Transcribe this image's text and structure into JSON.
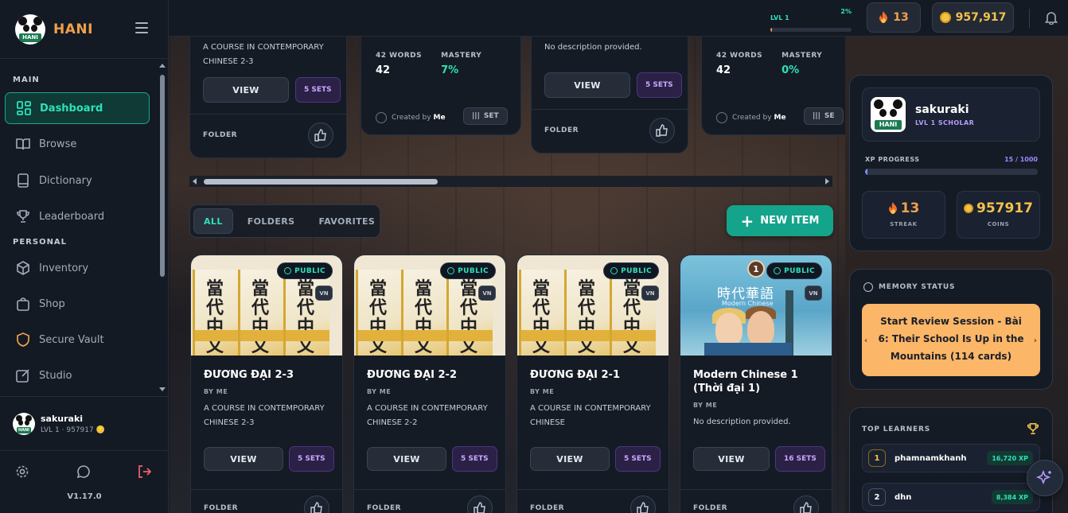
{
  "app": {
    "name": "HANI",
    "version": "V1.17.0"
  },
  "sidebar": {
    "sections": {
      "main": "MAIN",
      "personal": "PERSONAL"
    },
    "items": [
      {
        "label": "Dashboard",
        "icon": "dashboard-icon",
        "active": true
      },
      {
        "label": "Browse",
        "icon": "book-open-icon"
      },
      {
        "label": "Dictionary",
        "icon": "book-icon"
      },
      {
        "label": "Leaderboard",
        "icon": "trophy-icon"
      },
      {
        "label": "Inventory",
        "icon": "box-icon"
      },
      {
        "label": "Shop",
        "icon": "bag-icon"
      },
      {
        "label": "Secure Vault",
        "icon": "shield-icon"
      },
      {
        "label": "Studio",
        "icon": "edit-icon"
      }
    ],
    "user": {
      "name": "sakuraki",
      "meta": "LVL 1 · 957917 🪙"
    }
  },
  "topbar": {
    "level_label": "LVL 1",
    "level_percent_label": "2%",
    "level_progress": 0.02,
    "streak": "13",
    "coins": "957,917"
  },
  "top_row": [
    {
      "desc": "A COURSE IN CONTEMPORARY CHINESE 2-3",
      "view": "VIEW",
      "sets": "5 SETS",
      "folder": "FOLDER"
    },
    {
      "words_label": "42 WORDS",
      "words": "42",
      "mastery_label": "MASTERY",
      "mastery": "7%",
      "created_by": "Created by",
      "creator": "Me",
      "set": "SET"
    },
    {
      "desc": "No description provided.",
      "view": "VIEW",
      "sets": "5 SETS",
      "folder": "FOLDER"
    },
    {
      "words_label": "42 WORDS",
      "words": "42",
      "mastery_label": "MASTERY",
      "mastery": "0%",
      "created_by": "Created by",
      "creator": "Me",
      "set": "SE"
    }
  ],
  "tabs": {
    "all": "ALL",
    "folders": "FOLDERS",
    "favorites": "FAVORITES"
  },
  "new_item": "NEW ITEM",
  "cards": [
    {
      "title": "ĐƯƠNG ĐẠI 2-3",
      "by": "BY ME",
      "desc": "A COURSE IN CONTEMPORARY CHINESE 2-3",
      "view": "VIEW",
      "sets": "5 SETS",
      "folder": "FOLDER",
      "public": "PUBLIC",
      "lang": "VN",
      "cover_text": "當代中文課程"
    },
    {
      "title": "ĐƯƠNG ĐẠI 2-2",
      "by": "BY ME",
      "desc": "A COURSE IN CONTEMPORARY CHINESE 2-2",
      "view": "VIEW",
      "sets": "5 SETS",
      "folder": "FOLDER",
      "public": "PUBLIC",
      "lang": "VN",
      "cover_text": "當代中文課程"
    },
    {
      "title": "ĐƯƠNG ĐẠI 2-1",
      "by": "BY ME",
      "desc": "A COURSE IN CONTEMPORARY CHINESE",
      "view": "VIEW",
      "sets": "5 SETS",
      "folder": "FOLDER",
      "public": "PUBLIC",
      "lang": "VN",
      "cover_text": "當代中文課程"
    },
    {
      "title": "Modern Chinese 1 (Thời đại 1)",
      "by": "BY ME",
      "desc": "No description provided.",
      "view": "VIEW",
      "sets": "16 SETS",
      "folder": "FOLDER",
      "public": "PUBLIC",
      "lang": "VN",
      "badge": "1",
      "cover_title": "時代華語",
      "cover_sub": "Modern Chinese"
    }
  ],
  "profile": {
    "name": "sakuraki",
    "level": "LVL 1 SCHOLAR",
    "xp_label": "XP PROGRESS",
    "xp_value": "15 / 1000",
    "xp_progress": 0.015,
    "streak": "13",
    "streak_label": "STREAK",
    "coins": "957917",
    "coins_label": "COINS"
  },
  "memory": {
    "title": "MEMORY STATUS",
    "review": "Start Review Session - Bài 6: Their School Is Up in the Mountains (114 cards)"
  },
  "top_learners": {
    "title": "TOP LEARNERS",
    "rows": [
      {
        "rank": "1",
        "name": "phamnamkhanh",
        "xp": "16,720 XP"
      },
      {
        "rank": "2",
        "name": "dhn",
        "xp": "8,384 XP"
      }
    ]
  },
  "colors": {
    "accent": "#2fe0b9",
    "brand": "#f0a04b",
    "purple": "#c9a8ff",
    "review": "#fcb668"
  }
}
